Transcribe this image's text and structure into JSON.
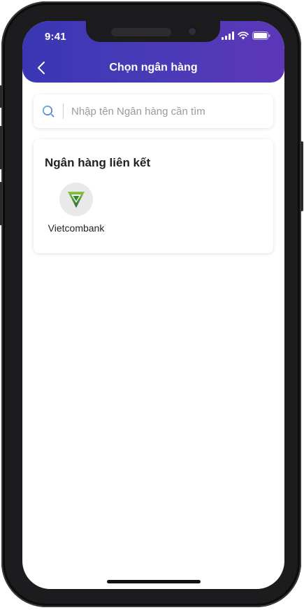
{
  "status_bar": {
    "time": "9:41"
  },
  "header": {
    "title": "Chọn ngân hàng",
    "background_colors": [
      "#3a36b3",
      "#5d36b9"
    ]
  },
  "search": {
    "placeholder": "Nhập tên Ngân hàng cần tìm",
    "value": "",
    "icon": "search-icon"
  },
  "linked_banks": {
    "title": "Ngân hàng liên kết",
    "items": [
      {
        "name": "Vietcombank",
        "icon": "vietcombank-logo",
        "brand_color": "#2e8b3a"
      }
    ]
  },
  "colors": {
    "accent": "#4b3bb8",
    "search_icon": "#5bbcd6",
    "text_primary": "#222222",
    "placeholder": "#9a9a9f"
  }
}
